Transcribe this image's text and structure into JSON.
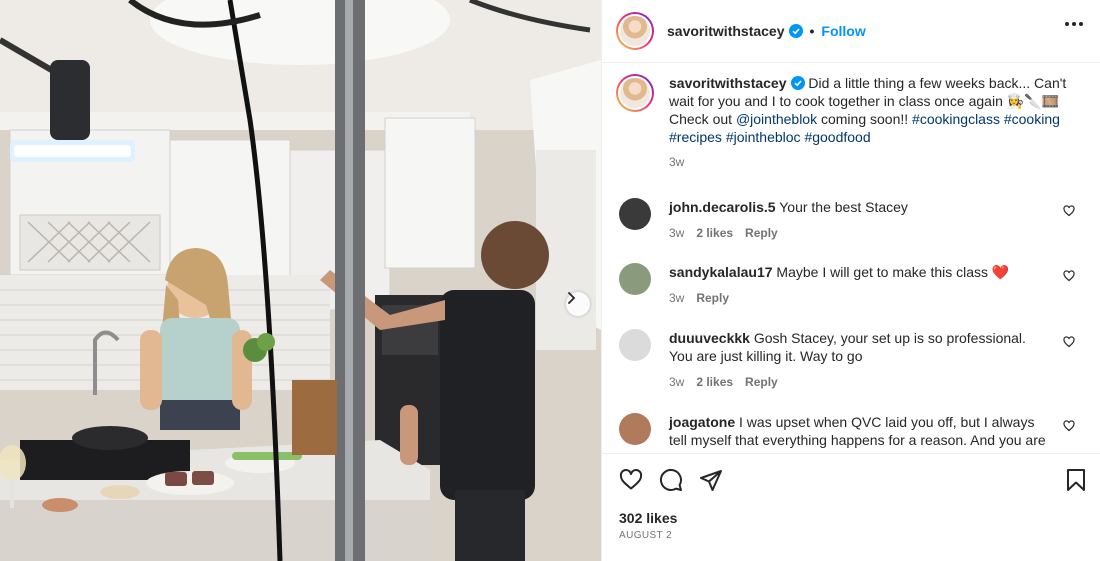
{
  "post": {
    "username": "savoritwithstacey",
    "verified": true,
    "follow_label": "Follow",
    "separator": "•",
    "more_icon": "more-options-icon"
  },
  "caption": {
    "username": "savoritwithstacey",
    "text_1": "Did a little thing a few weeks back... Can't wait for you and I to cook together in class once again 👩‍🍳🔪🎞️ Check out ",
    "mention": "@jointheblok",
    "text_2": " coming soon!! ",
    "hashtags": [
      "#cookingclass",
      "#cooking",
      "#recipes",
      "#jointhebloc",
      "#goodfood"
    ],
    "time": "3w"
  },
  "comments": [
    {
      "username": "john.decarolis.5",
      "text": "Your the best Stacey",
      "time": "3w",
      "likes": "2 likes",
      "reply": "Reply",
      "avatar_color": "#3a3a3a"
    },
    {
      "username": "sandykalalau17",
      "text": "Maybe I will get to make this class ❤️",
      "time": "3w",
      "likes": "",
      "reply": "Reply",
      "avatar_color": "#8a9a7c"
    },
    {
      "username": "duuuveckkk",
      "text": "Gosh Stacey, your set up is so professional. You are just killing it. Way to go",
      "time": "3w",
      "likes": "2 likes",
      "reply": "Reply",
      "avatar_color": "#dbdbdb"
    },
    {
      "username": "joagatone",
      "text": "I was upset when QVC laid you off, but I always tell myself that everything happens for a reason. And you are",
      "time": "",
      "likes": "",
      "reply": "",
      "avatar_color": "#b07a5c"
    }
  ],
  "actions": {
    "like_icon": "heart-icon",
    "comment_icon": "comment-icon",
    "share_icon": "share-icon",
    "save_icon": "bookmark-icon"
  },
  "likes_count": "302 likes",
  "post_date": "AUGUST 2",
  "media": {
    "next_icon": "chevron-right-icon"
  },
  "colors": {
    "link": "#00376b",
    "follow": "#0095f6",
    "muted": "#737373",
    "heart_red": "#e0242b"
  }
}
